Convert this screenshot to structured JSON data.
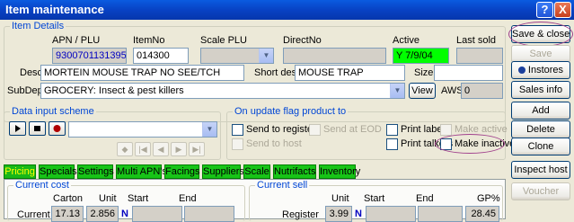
{
  "window": {
    "title": "Item maintenance",
    "help_label": "?",
    "close_label": "X"
  },
  "item_details": {
    "group_title": "Item Details",
    "apn_label": "APN / PLU",
    "apn_value": "9300701131395",
    "itemno_label": "ItemNo",
    "itemno_value": "014300",
    "scaleplu_label": "Scale PLU",
    "scaleplu_value": "",
    "directno_label": "DirectNo",
    "directno_value": "",
    "active_label": "Active",
    "active_value": "Y 7/9/04",
    "lastsold_label": "Last sold",
    "lastsold_value": "",
    "desc_label": "Desc",
    "desc_value": "MORTEIN MOUSE TRAP NO SEE/TCH",
    "shortdesc_label": "Short desc",
    "shortdesc_value": "MOUSE TRAP",
    "size_label": "Size",
    "size_value": "",
    "subdept_label": "SubDept",
    "subdept_value": "GROCERY: Insect & pest killers",
    "view_label": "View",
    "aws_label": "AWS",
    "aws_value": "0"
  },
  "data_input": {
    "group_title": "Data input scheme",
    "scheme_value": ""
  },
  "update_flag": {
    "group_title": "On update flag product to",
    "send_to_register": "Send to register",
    "send_at_eod": "Send at EOD",
    "send_to_host": "Send to host",
    "print_labels": "Print labels",
    "print_talkers": "Print talkers",
    "make_active": "Make active",
    "make_inactive": "Make inactive"
  },
  "tabs": [
    "Pricing",
    "Specials",
    "Settings",
    "Multi APN's",
    "Facings",
    "Suppliers",
    "Scale",
    "Nutrifacts",
    "Inventory"
  ],
  "current_cost": {
    "group_title": "Current cost",
    "carton_label": "Carton",
    "unit_label": "Unit",
    "start_label": "Start",
    "end_label": "End",
    "row_label": "Current",
    "carton_value": "17.13",
    "unit_value": "2.856",
    "n_flag": "N"
  },
  "current_sell": {
    "group_title": "Current sell",
    "unit_label": "Unit",
    "start_label": "Start",
    "end_label": "End",
    "gp_label": "GP%",
    "row_label": "Register",
    "unit_value": "3.99",
    "n_flag": "N",
    "gp_value": "28.45"
  },
  "side_buttons": {
    "save_close": "Save & close",
    "save": "Save",
    "instores": "Instores",
    "sales_info": "Sales info",
    "add": "Add",
    "delete": "Delete",
    "clone": "Clone",
    "inspect_host": "Inspect host",
    "voucher": "Voucher"
  },
  "colors": {
    "title_bar": "#0842c4",
    "active_field": "#00ff00",
    "tab_green": "#17c417",
    "annotation_circle": "#a0408c"
  }
}
